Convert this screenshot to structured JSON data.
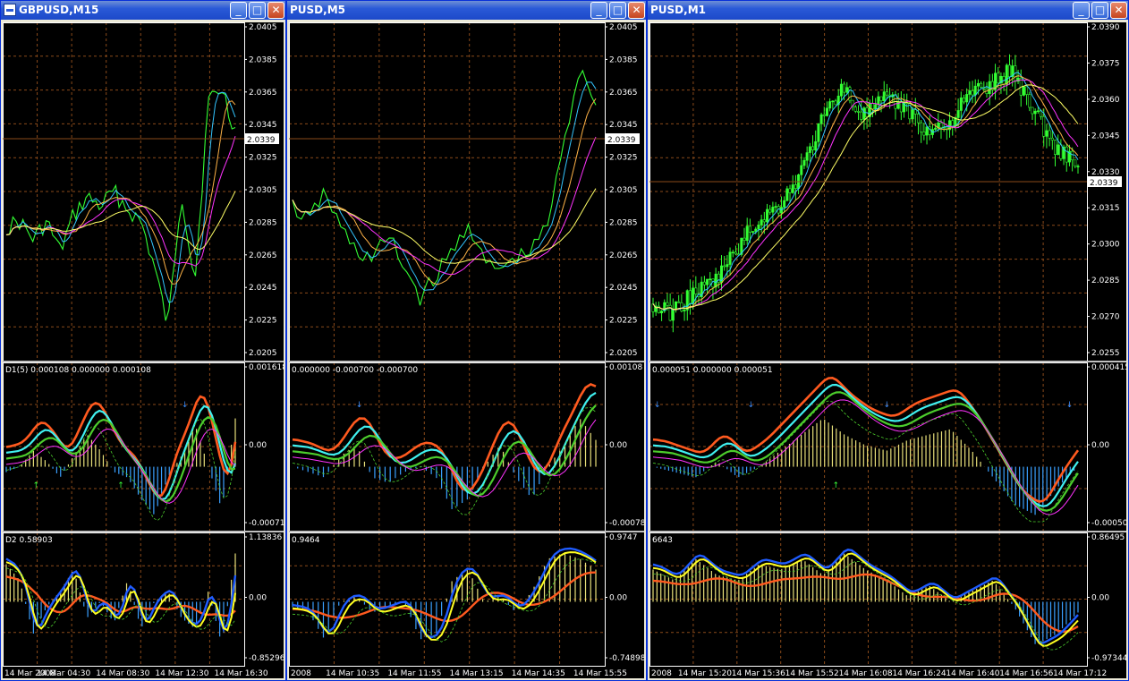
{
  "windows": [
    {
      "title": "GBPUSD,M15",
      "price_scale": [
        "2.0405",
        "2.0385",
        "2.0365",
        "2.0345",
        "2.0325",
        "2.0305",
        "2.0285",
        "2.0265",
        "2.0245",
        "2.0225",
        "2.0205"
      ],
      "current_price": "2.0339",
      "ind1": {
        "label": "D1(5) 0.000108 0.000000 0.000108",
        "scale": [
          "0.001618",
          "0.00",
          "-0.00071"
        ]
      },
      "ind2": {
        "label": "D2 0.58903",
        "scale": [
          "1.13836",
          "0.00",
          "-0.85296"
        ]
      },
      "time_axis": [
        "14 Mar 2008",
        "14 Mar 04:30",
        "14 Mar 08:30",
        "14 Mar 12:30",
        "14 Mar 16:30"
      ]
    },
    {
      "title": "PUSD,M5",
      "price_scale": [
        "2.0405",
        "2.0385",
        "2.0365",
        "2.0345",
        "2.0325",
        "2.0305",
        "2.0285",
        "2.0265",
        "2.0245",
        "2.0225",
        "2.0205"
      ],
      "current_price": "2.0339",
      "ind1": {
        "label": "0.000000 -0.000700 -0.000700",
        "scale": [
          "0.00108",
          "0.00",
          "-0.00078"
        ]
      },
      "ind2": {
        "label": "0.9464",
        "scale": [
          "0.9747",
          "0.00",
          "-0.74898"
        ]
      },
      "time_axis": [
        "2008",
        "14 Mar 10:35",
        "14 Mar 11:55",
        "14 Mar 13:15",
        "14 Mar 14:35",
        "14 Mar 15:55"
      ]
    },
    {
      "title": "PUSD,M1",
      "price_scale": [
        "2.0390",
        "2.0375",
        "2.0360",
        "2.0345",
        "2.0330",
        "2.0315",
        "2.0300",
        "2.0285",
        "2.0270",
        "2.0255"
      ],
      "current_price": "2.0339",
      "ind1": {
        "label": "0.000051 0.000000 0.000051",
        "scale": [
          "0.000415",
          "0.00",
          "-0.00050"
        ]
      },
      "ind2": {
        "label": "6643",
        "scale": [
          "0.86495",
          "0.00",
          "-0.97344"
        ]
      },
      "time_axis": [
        "2008",
        "14 Mar 15:20",
        "14 Mar 15:36",
        "14 Mar 15:52",
        "14 Mar 16:08",
        "14 Mar 16:24",
        "14 Mar 16:40",
        "14 Mar 16:56",
        "14 Mar 17:12"
      ]
    }
  ],
  "window_buttons": {
    "minimize": "_",
    "maximize": "□",
    "close": "✕"
  },
  "colors": {
    "background": "#000000",
    "grid": "#8a4a1a",
    "price_line": "#33ff33",
    "ma_fast": "#33c5ff",
    "ma_mid": "#ffb347",
    "ma_slow": "#ff33ff",
    "ma_long": "#ffff66",
    "signal_red": "#ff5a1f",
    "signal_cyan": "#40f0f0",
    "signal_green": "#4ccd2c",
    "hist_pos": "#e8e07a",
    "hist_neg": "#3aa0ff",
    "oscillator_yellow": "#ffff22",
    "oscillator_blue": "#1f5cff",
    "arrow_up": "#3aff3a",
    "arrow_down": "#3a8dff"
  },
  "icons": [
    "chart-window-icon",
    "minimize-icon",
    "maximize-icon",
    "close-icon",
    "up-arrow-icon",
    "down-arrow-icon"
  ]
}
